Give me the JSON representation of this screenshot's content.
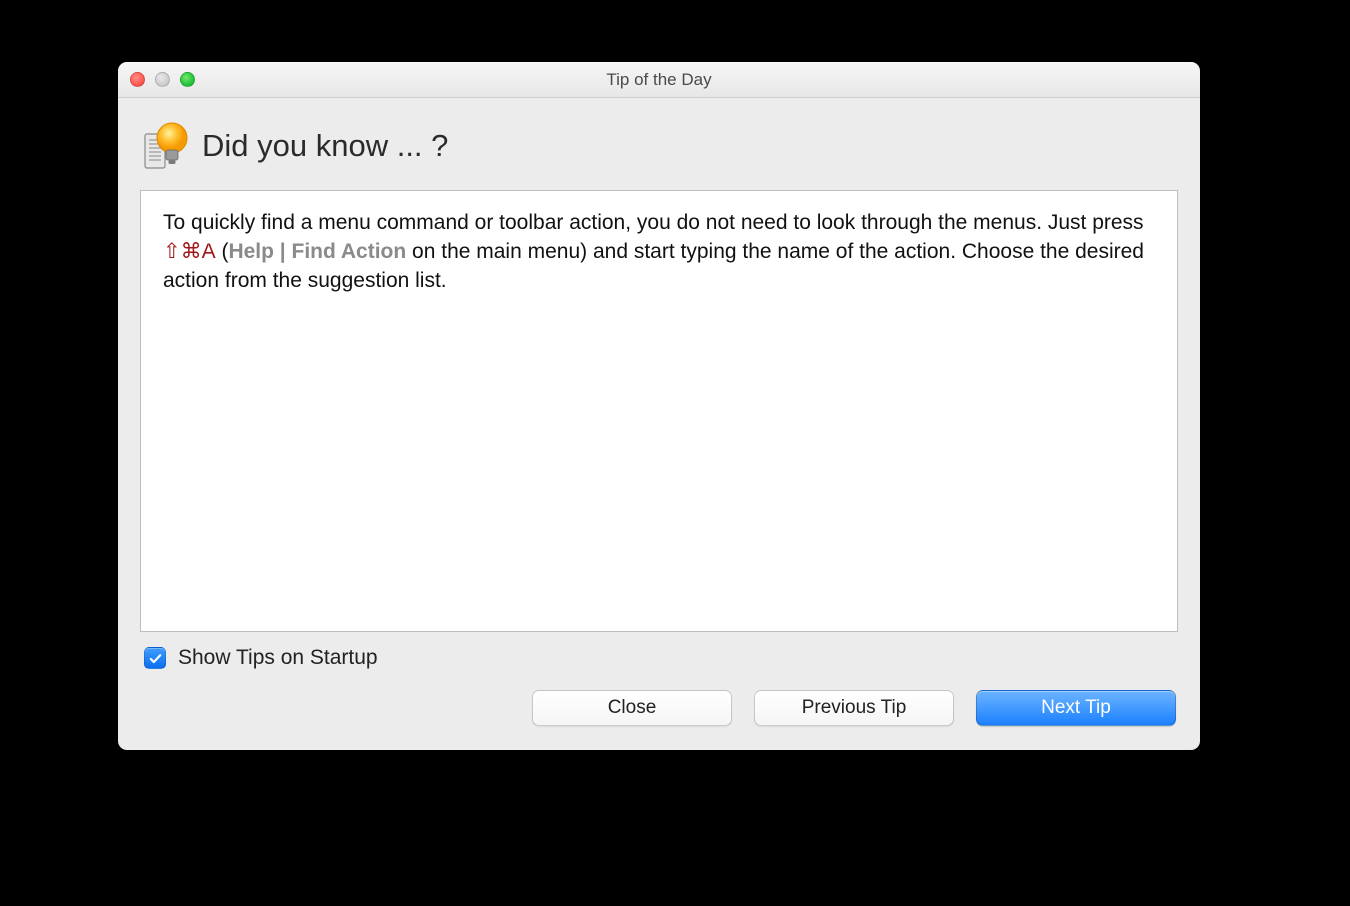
{
  "window": {
    "title": "Tip of the Day"
  },
  "heading": "Did you know ... ?",
  "tip": {
    "pre": "To quickly find a menu command or toolbar action, you do not need to look through the menus. Just press ",
    "shortcut": "⇧⌘A",
    "open_paren": " (",
    "menu_path": "Help | Find Action",
    "close_paren": " on the main menu) and start typing the name of the action. Choose the desired action from the suggestion list."
  },
  "checkbox": {
    "label": "Show Tips on Startup",
    "checked": true
  },
  "buttons": {
    "close": "Close",
    "previous": "Previous Tip",
    "next": "Next Tip"
  }
}
